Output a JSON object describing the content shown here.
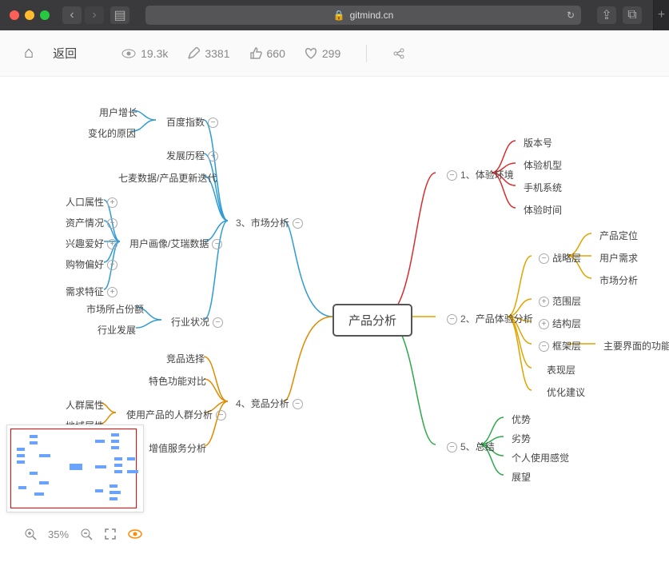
{
  "browser": {
    "back": "‹",
    "forward": "›",
    "sidebar": "▤",
    "lock": "🔒",
    "url": "gitmind.cn",
    "reload": "↻",
    "share": "⇪",
    "tabs": "⧉",
    "add": "+"
  },
  "header": {
    "home": "⌂",
    "back": "返回",
    "views": "19.3k",
    "edits": "3381",
    "likes": "660",
    "favs": "299",
    "share": "∝"
  },
  "map": {
    "root": "产品分析",
    "b1": {
      "idx": "1、",
      "t": "体验环境",
      "c": {
        "a": "版本号",
        "b": "体验机型",
        "c": "手机系统",
        "d": "体验时间"
      }
    },
    "b2": {
      "idx": "2、",
      "t": "产品体验分析",
      "c": {
        "a": "战略层",
        "b": "范围层",
        "c": "结构层",
        "d": "框架层",
        "e": "表现层",
        "f": "优化建议"
      },
      "c2a": {
        "a": "产品定位",
        "b": "用户需求",
        "c": "市场分析"
      },
      "c2d": {
        "a": "主要界面的功能区"
      }
    },
    "b3": {
      "idx": "3、",
      "t": "市场分析",
      "c": {
        "a": "百度指数",
        "b": "发展历程",
        "c": "七麦数据/产品更新迭代",
        "d": "用户画像/艾瑞数据",
        "e": "行业状况"
      },
      "c3a": {
        "a": "用户增长",
        "b": "变化的原因"
      },
      "c3d": {
        "a": "人口属性",
        "b": "资产情况",
        "c": "兴趣爱好",
        "d": "购物偏好",
        "e": "需求特征"
      },
      "c3e": {
        "a": "市场所占份额",
        "b": "行业发展"
      }
    },
    "b4": {
      "idx": "4、",
      "t": "竞品分析",
      "c": {
        "a": "竞品选择",
        "b": "特色功能对比",
        "c": "使用产品的人群分析",
        "d": "增值服务分析"
      },
      "c4c": {
        "a": "人群属性",
        "b": "地域属性"
      }
    },
    "b5": {
      "idx": "5、",
      "t": "总结",
      "c": {
        "a": "优势",
        "b": "劣势",
        "c": "个人使用感觉",
        "d": "展望"
      }
    }
  },
  "colors": {
    "b1": "#d62e2e",
    "b2": "#e0a400",
    "b3": "#2e9bd6",
    "b4": "#e08a00",
    "b5": "#2ea84a"
  },
  "bottom": {
    "zoom": "35%",
    "plus": "+",
    "minus": "−",
    "fit": "⛶",
    "eye": "👁"
  }
}
